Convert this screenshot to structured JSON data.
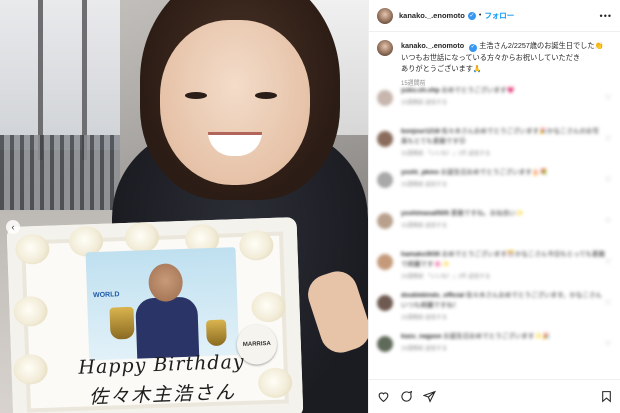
{
  "header": {
    "username": "kanako._.enomoto",
    "separator": "•",
    "follow_label": "フォロー",
    "more_icon": "more-horizontal-icon"
  },
  "caption": {
    "username": "kanako._.enomoto",
    "text_line1": "主浩さん2/2257歳のお誕生日でした👏",
    "text_line2": "いつもお世話になっている方々からお祝いしていただき",
    "text_line3": "ありがとうございます🙏",
    "time": "15週間前"
  },
  "photo": {
    "cake_line1": "Happy Birthday",
    "cake_line2": "佐々木主浩さん",
    "plaque_text": "MARRISA",
    "brand_text": "WORLD",
    "prev_icon": "chevron-left-icon"
  },
  "comments": [
    {
      "user": "yuko.oh.ohp",
      "text": "おめでとうございます💗",
      "meta": "15週間前  返信する",
      "avatar_color": "#c7b6ad"
    },
    {
      "user": "bonjour1218",
      "text": "佐々木さんおめでとうございます🎉かなこさんのお写真もとても素敵です😊",
      "meta": "15週間前  「いいね！」1件  返信する",
      "avatar_color": "#8a6c5c"
    },
    {
      "user": "yoshi_pkmo",
      "text": "お誕生日おめでとうございます🎂💐",
      "meta": "15週間前  返信する",
      "avatar_color": "#a8a8a8"
    },
    {
      "user": "yoshimasa0505",
      "text": "素敵ですね。お似合い✨",
      "meta": "15週間前  返信する",
      "avatar_color": "#b8a08c"
    },
    {
      "user": "hamako3030",
      "text": "おめでとうございます🎊かなこさん今日もとっても素敵で綺麗です🌸✨",
      "meta": "15週間前  「いいね！」2件  返信する",
      "avatar_color": "#c49a7a"
    },
    {
      "user": "doublebinds_official",
      "text": "佐々木さんおめでとうございます。かなこさんいつも綺麗ですね！",
      "meta": "15週間前  返信する",
      "avatar_color": "#6e5a50"
    },
    {
      "user": "kazu_nagase",
      "text": "お誕生日おめでとうございます✨🎉",
      "meta": "15週間前  返信する",
      "avatar_color": "#5f6a5a"
    }
  ],
  "actions": {
    "like_icon": "heart-icon",
    "comment_icon": "comment-icon",
    "share_icon": "share-icon",
    "save_icon": "bookmark-icon"
  }
}
